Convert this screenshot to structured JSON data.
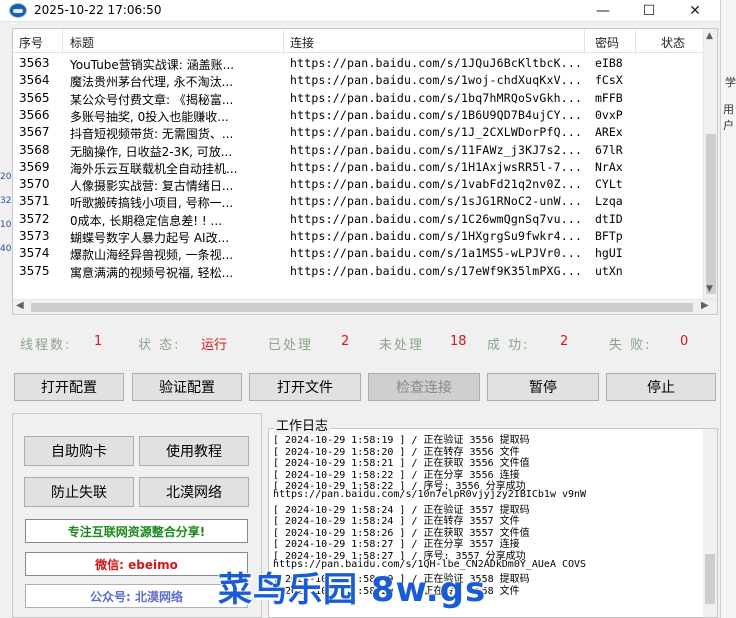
{
  "window": {
    "title": "2025-10-22 17:06:50",
    "controls": [
      "—",
      "☐",
      "✕"
    ]
  },
  "side_strip": {
    "a": "学",
    "b": "用户"
  },
  "left_strip": [
    "20",
    "32",
    "10",
    "40"
  ],
  "table": {
    "headers": {
      "num": "序号",
      "title": "标题",
      "link": "连接",
      "code": "密码",
      "status": "状态"
    },
    "rows": [
      {
        "num": "3563",
        "title": "YouTube营销实战课: 涵盖账...",
        "link": "https://pan.baidu.com/s/1JQuJ6BcKltbcK...",
        "code": "eIB8"
      },
      {
        "num": "3564",
        "title": "魔法贵州茅台代理, 永不淘汰...",
        "link": "https://pan.baidu.com/s/1woj-chdXuqKxV...",
        "code": "fCsX"
      },
      {
        "num": "3565",
        "title": "某公众号付费文章: 《揭秘富...",
        "link": "https://pan.baidu.com/s/1bq7hMRQoSvGkh...",
        "code": "mFFB"
      },
      {
        "num": "3566",
        "title": "多账号抽奖, 0投入也能赚收...",
        "link": "https://pan.baidu.com/s/1B6U9QD7B4ujCY...",
        "code": "0vxP"
      },
      {
        "num": "3567",
        "title": "抖音短视频带货: 无需囤货、...",
        "link": "https://pan.baidu.com/s/1J_2CXLWDorPfQ...",
        "code": "AREx"
      },
      {
        "num": "3568",
        "title": "无脑操作, 日收益2-3K, 可放...",
        "link": "https://pan.baidu.com/s/11FAWz_j3KJ7s2...",
        "code": "67lR"
      },
      {
        "num": "3569",
        "title": "海外乐云互联载机全自动挂机...",
        "link": "https://pan.baidu.com/s/1H1AxjwsRR5l-7...",
        "code": "NrAx"
      },
      {
        "num": "3570",
        "title": "人像摄影实战营: 复古情绪日...",
        "link": "https://pan.baidu.com/s/1vabFd21q2nv0Z...",
        "code": "CYLt"
      },
      {
        "num": "3571",
        "title": "听歌搬砖搞钱小项目, 号称一...",
        "link": "https://pan.baidu.com/s/1sJG1RNoC2-unW...",
        "code": "Lzqa"
      },
      {
        "num": "3572",
        "title": "0成本, 长期稳定信息差! ! ...",
        "link": "https://pan.baidu.com/s/1C26wmQgnSq7vu...",
        "code": "dtID"
      },
      {
        "num": "3573",
        "title": "蝴蝶号数字人暴力起号 AI改...",
        "link": "https://pan.baidu.com/s/1HXgrgSu9fwkr4...",
        "code": "BFTp"
      },
      {
        "num": "3574",
        "title": "爆款山海经异兽视频, 一条视...",
        "link": "https://pan.baidu.com/s/1a1MS5-wLPJVr0...",
        "code": "hgUI"
      },
      {
        "num": "3575",
        "title": "寓意满满的视频号祝福, 轻松...",
        "link": "https://pan.baidu.com/s/17eWf9K35lmPXG...",
        "code": "utXn"
      }
    ]
  },
  "stats": {
    "threads_label": "线程数:",
    "threads_value": "1",
    "state_label": "状  态:",
    "state_value": "运行",
    "done_label": "已处理",
    "done_value": "2",
    "pending_label": "未处理",
    "pending_value": "18",
    "success_label": "成  功:",
    "success_value": "2",
    "fail_label": "失  败:",
    "fail_value": "0"
  },
  "buttons": {
    "open_config": "打开配置",
    "verify_config": "验证配置",
    "open_file": "打开文件",
    "check_link": "检查连接",
    "pause": "暂停",
    "stop": "停止"
  },
  "left_panel": {
    "buy_card": "自助购卡",
    "tutorial": "使用教程",
    "anti_lost": "防止失联",
    "beihan": "北漠网络",
    "promo1": "专注互联网资源整合分享!",
    "promo2": "微信: ebeimo",
    "promo3": "公众号: 北漠网络"
  },
  "colors": {
    "promo1": "#1a8a1a",
    "promo2": "#d21818",
    "promo3": "#5a6fc8",
    "watermark": "#1a5cd6"
  },
  "log": {
    "title": "工作日志",
    "lines": [
      "[ 2024-10-29 1:58:19 ] / 正在验证 3556 提取码",
      "[ 2024-10-29 1:58:20 ] / 正在转存 3556 文件",
      "[ 2024-10-29 1:58:21 ] / 正在获取 3556 文件值",
      "[ 2024-10-29 1:58:22 ] / 正在分享 3556 连接",
      "[ 2024-10-29 1:58:22 ] / 序号: 3556 分享成功",
      "https://pan.baidu.com/s/10n7elpR0vjyjzy2IBICb1w  v9nW",
      "[ 2024-10-29 1:58:24 ] / 正在验证 3557 提取码",
      "[ 2024-10-29 1:58:24 ] / 正在转存 3557 文件",
      "[ 2024-10-29 1:58:26 ] / 正在获取 3557 文件值",
      "[ 2024-10-29 1:58:27 ] / 正在分享 3557 连接",
      "[ 2024-10-29 1:58:27 ] / 序号: 3557 分享成功",
      "https://pan.baidu.com/s/1QH-lbe_CN2ADkDm0Y_AUeA  COVS",
      "[ 2024-10-29 1:58:29 ] / 正在验证 3558 提取码",
      "[ 2024-10-29 1:58:29 ] / 正在转存 3558 文件"
    ]
  },
  "watermark": "菜鸟乐园 8w.gs"
}
